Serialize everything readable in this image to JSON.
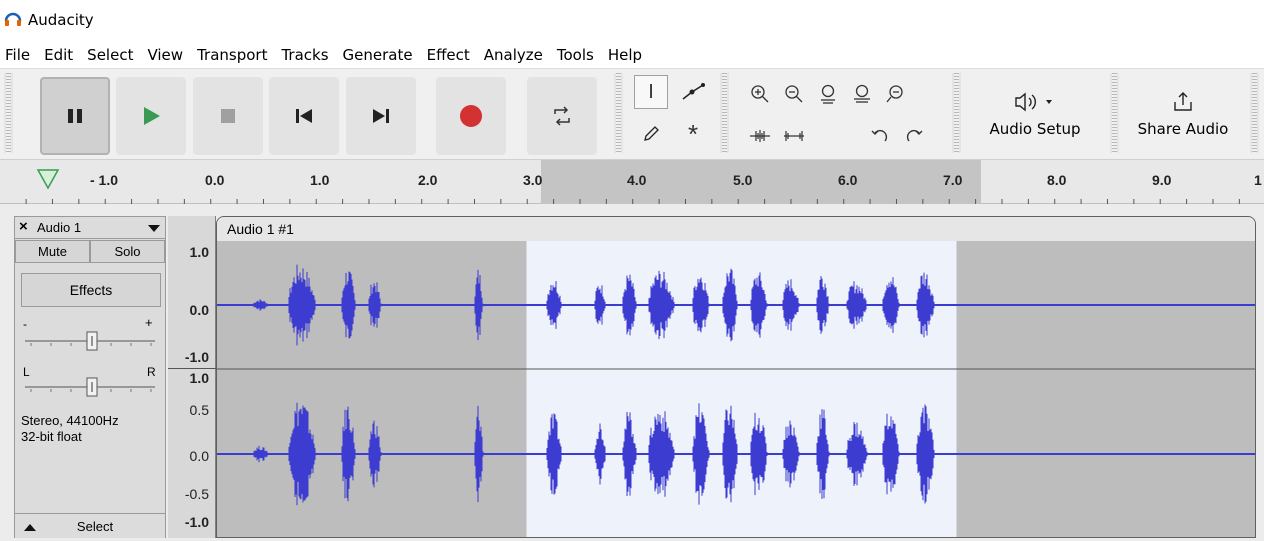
{
  "app": {
    "title": "Audacity"
  },
  "menu": [
    "File",
    "Edit",
    "Select",
    "View",
    "Transport",
    "Tracks",
    "Generate",
    "Effect",
    "Analyze",
    "Tools",
    "Help"
  ],
  "toolbar": {
    "audio_setup_label": "Audio Setup",
    "share_audio_label": "Share Audio",
    "play_color": "#3a9a54",
    "record_color": "#d23232"
  },
  "timeline": {
    "ticks": [
      "- 1.0",
      "0.0",
      "1.0",
      "2.0",
      "3.0",
      "4.0",
      "5.0",
      "6.0",
      "7.0",
      "8.0",
      "9.0",
      "1"
    ]
  },
  "track": {
    "name": "Audio 1",
    "mute_label": "Mute",
    "solo_label": "Solo",
    "effects_label": "Effects",
    "gain_minus": "-",
    "gain_plus": "+",
    "pan_left": "L",
    "pan_right": "R",
    "info_line1": "Stereo, 44100Hz",
    "info_line2": "32-bit float",
    "select_label": "Select",
    "clip_name": "Audio 1 #1",
    "scale_ch1": [
      "1.0",
      "0.0",
      "-1.0"
    ],
    "scale_ch2": [
      "1.0",
      "0.5",
      "0.0",
      "-0.5",
      "-1.0"
    ],
    "wave_color": "#3c3cd0",
    "selection_time": [
      3.0,
      7.0
    ]
  }
}
